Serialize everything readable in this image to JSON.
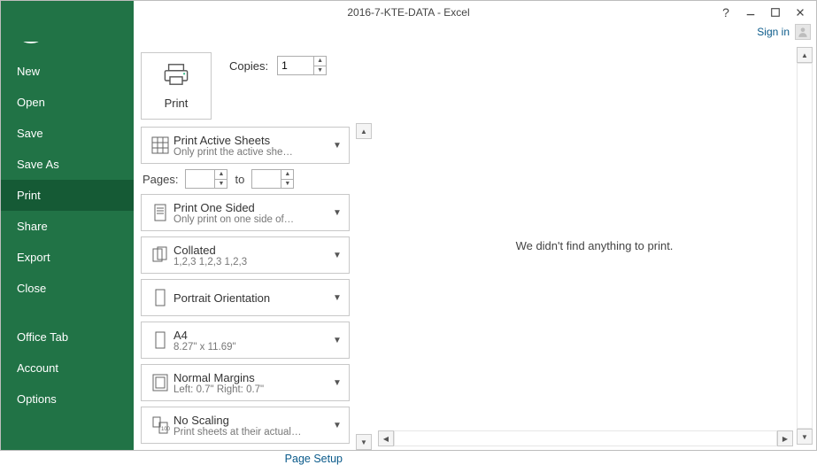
{
  "window": {
    "title": "2016-7-KTE-DATA - Excel",
    "sign_in": "Sign in"
  },
  "sidebar": {
    "items": [
      {
        "label": "New"
      },
      {
        "label": "Open"
      },
      {
        "label": "Save"
      },
      {
        "label": "Save As"
      },
      {
        "label": "Print"
      },
      {
        "label": "Share"
      },
      {
        "label": "Export"
      },
      {
        "label": "Close"
      }
    ],
    "lower": [
      {
        "label": "Office Tab"
      },
      {
        "label": "Account"
      },
      {
        "label": "Options"
      }
    ],
    "active_index": 4
  },
  "print": {
    "tile_label": "Print",
    "copies_label": "Copies:",
    "copies_value": "1",
    "pages_label": "Pages:",
    "pages_from": "",
    "to_label": "to",
    "pages_to": "",
    "page_setup": "Page Setup",
    "settings": [
      {
        "title": "Print Active Sheets",
        "sub": "Only print the active she…"
      },
      {
        "title": "Print One Sided",
        "sub": "Only print on one side of…"
      },
      {
        "title": "Collated",
        "sub": "1,2,3    1,2,3    1,2,3"
      },
      {
        "title": "Portrait Orientation",
        "sub": ""
      },
      {
        "title": "A4",
        "sub": "8.27\" x 11.69\""
      },
      {
        "title": "Normal Margins",
        "sub": "Left:  0.7\"    Right:  0.7\""
      },
      {
        "title": "No Scaling",
        "sub": "Print sheets at their actual…"
      }
    ]
  },
  "preview": {
    "empty_msg": "We didn't find anything to print."
  }
}
